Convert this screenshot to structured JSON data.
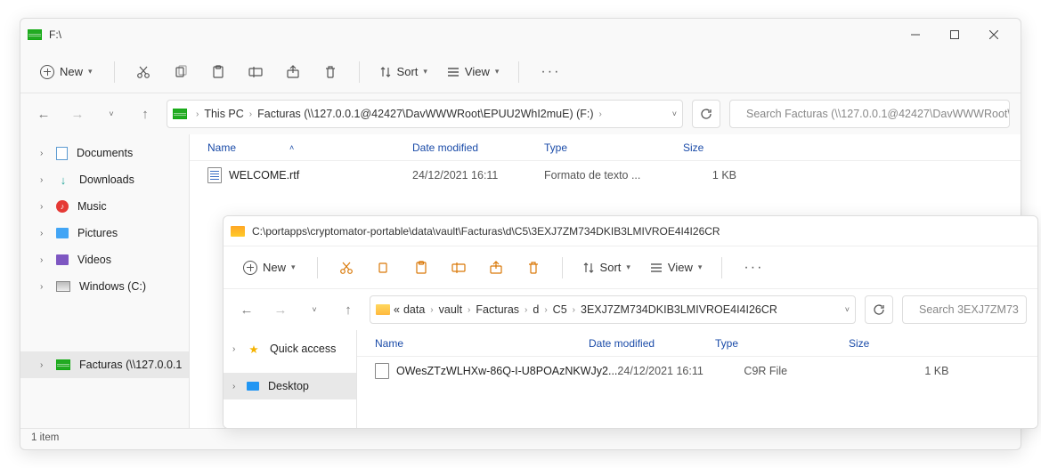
{
  "window1": {
    "title": "F:\\",
    "toolbar": {
      "new": "New",
      "sort": "Sort",
      "view": "View",
      "more": "···"
    },
    "nav": {
      "breadcrumbs": [
        "This PC",
        "Facturas (\\\\127.0.0.1@42427\\DavWWWRoot\\EPUU2WhI2muE) (F:)"
      ],
      "search_placeholder": "Search Facturas (\\\\127.0.0.1@42427\\DavWWWRoot\\EP..."
    },
    "sidebar": [
      {
        "label": "Documents"
      },
      {
        "label": "Downloads"
      },
      {
        "label": "Music"
      },
      {
        "label": "Pictures"
      },
      {
        "label": "Videos"
      },
      {
        "label": "Windows (C:)"
      },
      {
        "label": "Facturas (\\\\127.0.0.1"
      }
    ],
    "columns": {
      "name": "Name",
      "date": "Date modified",
      "type": "Type",
      "size": "Size"
    },
    "rows": [
      {
        "name": "WELCOME.rtf",
        "date": "24/12/2021 16:11",
        "type": "Formato de texto ...",
        "size": "1 KB"
      }
    ],
    "status": "1 item"
  },
  "window2": {
    "title": "C:\\portapps\\cryptomator-portable\\data\\vault\\Facturas\\d\\C5\\3EXJ7ZM734DKIB3LMIVROE4I4I26CR",
    "toolbar": {
      "new": "New",
      "sort": "Sort",
      "view": "View",
      "more": "···"
    },
    "nav": {
      "breadcrumbs_prefix": "«",
      "breadcrumbs": [
        "data",
        "vault",
        "Facturas",
        "d",
        "C5",
        "3EXJ7ZM734DKIB3LMIVROE4I4I26CR"
      ],
      "search_placeholder": "Search 3EXJ7ZM73"
    },
    "sidebar": [
      {
        "label": "Quick access"
      },
      {
        "label": "Desktop"
      }
    ],
    "columns": {
      "name": "Name",
      "date": "Date modified",
      "type": "Type",
      "size": "Size"
    },
    "rows": [
      {
        "name": "OWesZTzWLHXw-86Q-I-U8POAzNKWJy2...",
        "date": "24/12/2021 16:11",
        "type": "C9R File",
        "size": "1 KB"
      }
    ]
  }
}
